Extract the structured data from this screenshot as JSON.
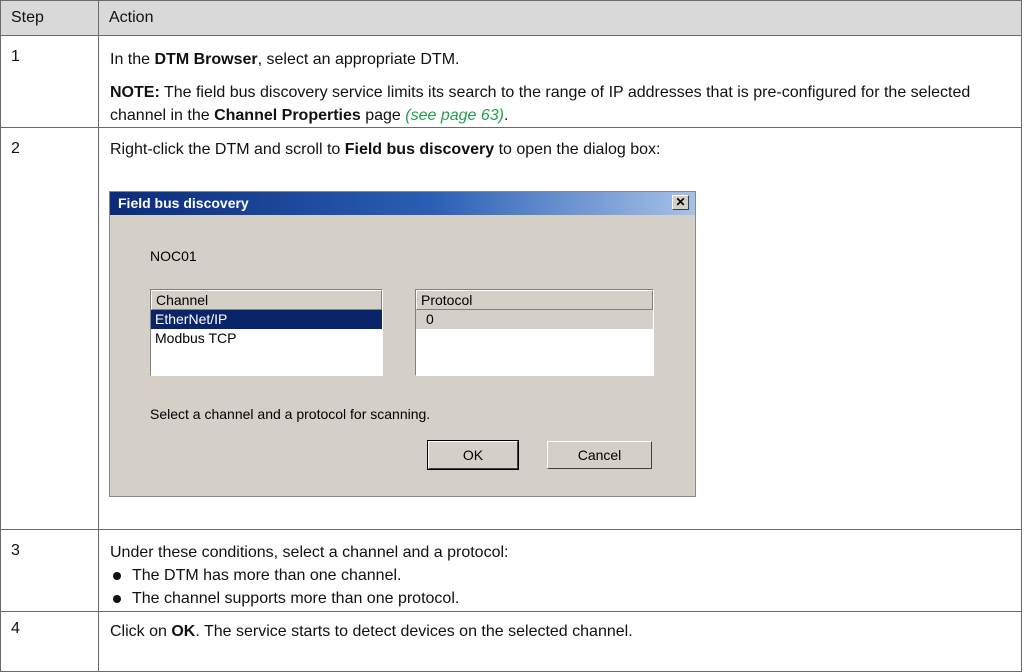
{
  "table": {
    "headers": [
      "Step",
      "Action"
    ],
    "rows": [
      {
        "step": "1",
        "line1_pre": "In the ",
        "line1_bold": "DTM Browser",
        "line1_post": ", select an appropriate DTM.",
        "note_label": "NOTE:",
        "note_text_a": " The field bus discovery service limits its search to the range of IP addresses that is pre-configured for the selected channel in the ",
        "note_bold": "Channel Properties",
        "note_text_b": " page ",
        "note_link": "(see page 63)",
        "note_end": "."
      },
      {
        "step": "2",
        "text_pre": "Right-click the DTM and scroll to ",
        "text_bold": "Field bus discovery",
        "text_post": " to open the dialog box:"
      },
      {
        "step": "3",
        "text": "Under these conditions, select a channel and a protocol:",
        "bullets": [
          "The DTM has more than one channel.",
          "The channel supports more than one protocol."
        ]
      },
      {
        "step": "4",
        "text_pre": "Click on ",
        "text_bold": "OK",
        "text_post": ". The service starts to detect devices on the selected channel."
      }
    ]
  },
  "dialog": {
    "title": "Field bus discovery",
    "close_glyph": "✕",
    "dtm_name": "NOC01",
    "channel_header": "Channel",
    "channels": [
      "EtherNet/IP",
      "Modbus TCP"
    ],
    "selected_channel": "EtherNet/IP",
    "protocol_header": "Protocol",
    "protocols": [
      "0"
    ],
    "hint": "Select a channel and a protocol for scanning.",
    "ok_label": "OK",
    "cancel_label": "Cancel"
  }
}
